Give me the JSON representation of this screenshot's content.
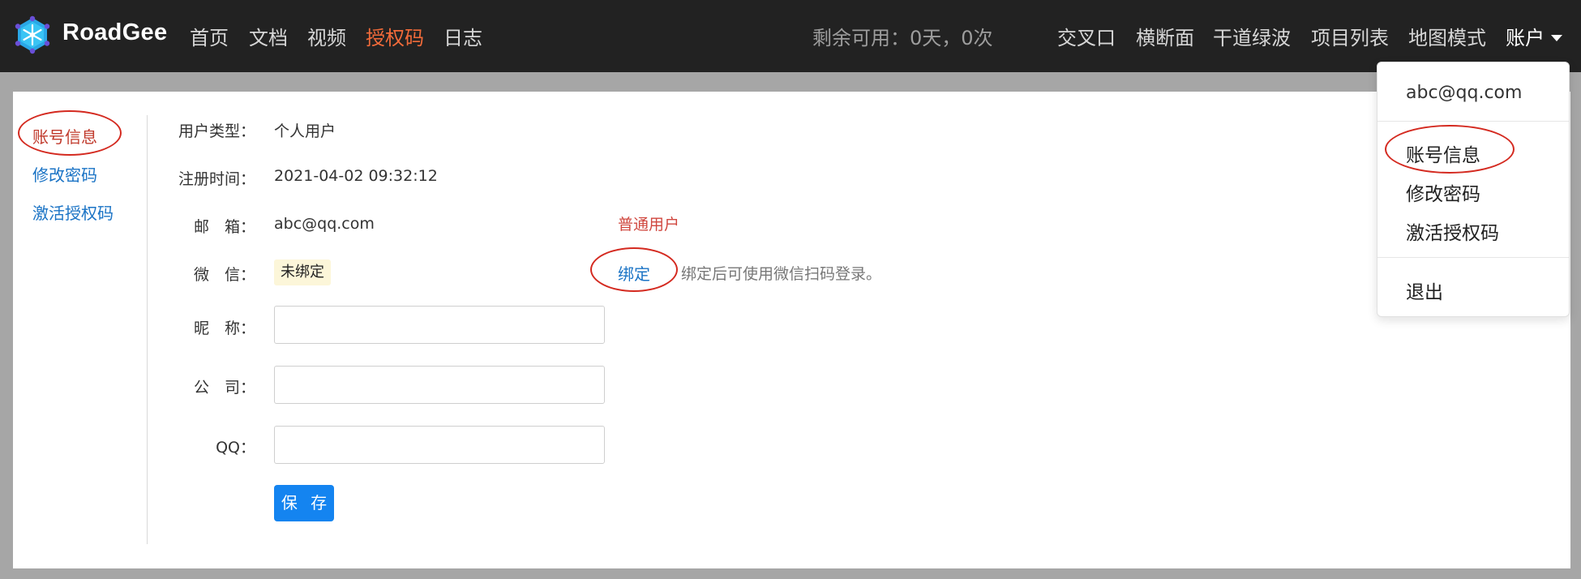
{
  "app": {
    "brand": "RoadGee",
    "nav_left": [
      "首页",
      "文档",
      "视频",
      "授权码",
      "日志"
    ],
    "active_nav": "授权码",
    "remaining": "剩余可用：0天，0次",
    "nav_right": [
      "交叉口",
      "横断面",
      "干道绿波",
      "项目列表",
      "地图模式"
    ],
    "account_label": "账户"
  },
  "sidebar": {
    "items": [
      {
        "label": "账号信息",
        "active": true
      },
      {
        "label": "修改密码",
        "active": false
      },
      {
        "label": "激活授权码",
        "active": false
      }
    ]
  },
  "profile": {
    "user_type": {
      "label": "用户类型：",
      "value": "个人用户"
    },
    "register_time": {
      "label": "注册时间：",
      "value": "2021-04-02 09:32:12"
    },
    "email": {
      "label": "邮　箱：",
      "value": "abc@qq.com",
      "tag": "普通用户"
    },
    "wechat": {
      "label": "微　信：",
      "status": "未绑定",
      "bind_link": "绑定",
      "hint": "绑定后可使用微信扫码登录。"
    },
    "nickname": {
      "label": "昵　称：",
      "value": ""
    },
    "company": {
      "label": "公　司：",
      "value": ""
    },
    "qq": {
      "label": "QQ：",
      "value": ""
    },
    "save_label": "保 存"
  },
  "dropdown": {
    "email": "abc@qq.com",
    "items": [
      "账号信息",
      "修改密码",
      "激活授权码"
    ],
    "logout": "退出"
  },
  "colors": {
    "navbar_bg": "#222222",
    "active_nav": "#f26b3a",
    "link": "#1a73c5",
    "annotation": "#d42a20",
    "primary_button": "#1484f0"
  }
}
